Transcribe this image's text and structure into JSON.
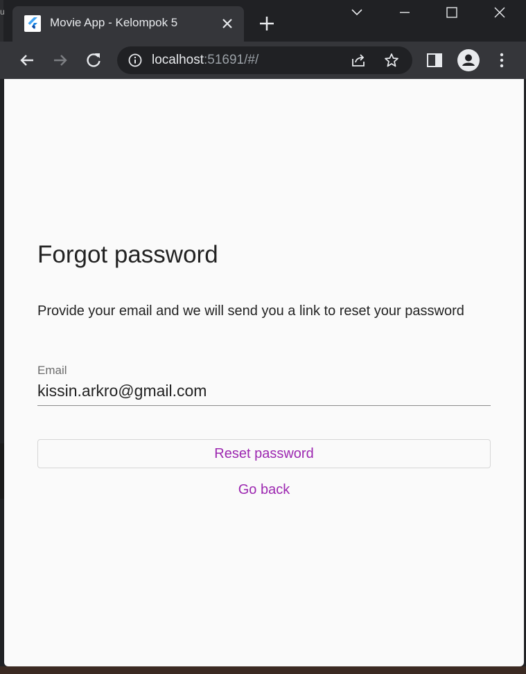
{
  "browser": {
    "tab": {
      "title": "Movie App - Kelompok 5"
    },
    "address": {
      "host": "localhost",
      "rest": ":51691/#/"
    },
    "left_sliver_char": "u"
  },
  "page": {
    "title": "Forgot password",
    "description": "Provide your email and we will send you a link to reset your password",
    "email": {
      "label": "Email",
      "value": "kissin.arkro@gmail.com"
    },
    "reset_button": "Reset password",
    "go_back": "Go back"
  },
  "colors": {
    "accent": "#9c27b0",
    "page_background": "#fafafa",
    "browser_dark": "#202124",
    "toolbar": "#35363a"
  }
}
